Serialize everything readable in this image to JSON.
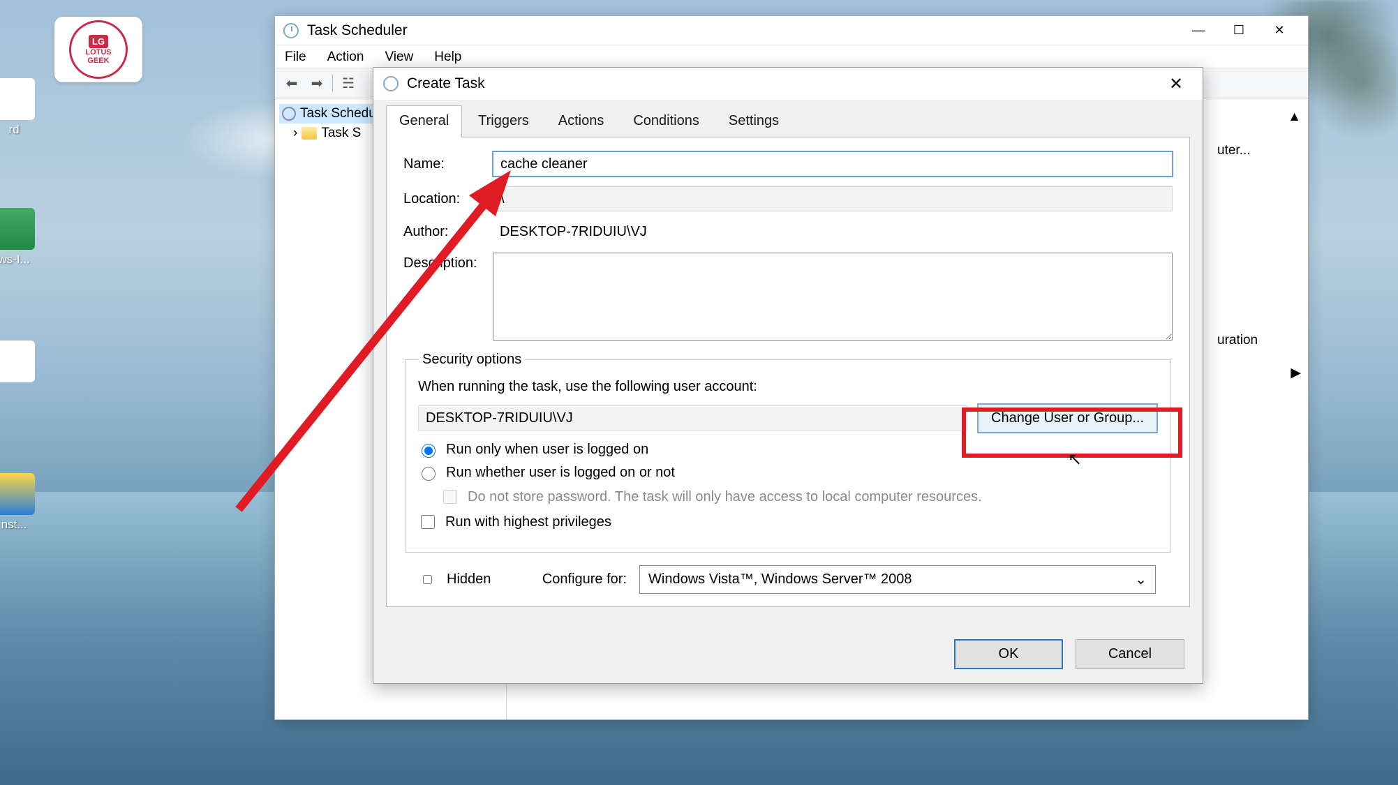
{
  "desktop": {
    "icons": [
      {
        "label": "rd"
      },
      {
        "label": "ws-I..."
      },
      {
        "label": ""
      },
      {
        "label": "nst..."
      }
    ],
    "logo": {
      "text_top": "LOTUS",
      "text_bottom": "GEEK",
      "badge": "LG"
    }
  },
  "parent_window": {
    "title": "Task Scheduler",
    "menu": [
      "File",
      "Action",
      "View",
      "Help"
    ],
    "tree": {
      "root": "Task Scheduler",
      "child": "Task S"
    },
    "right_pane_snippets": [
      "uter...",
      "uration"
    ]
  },
  "dialog": {
    "title": "Create Task",
    "tabs": [
      "General",
      "Triggers",
      "Actions",
      "Conditions",
      "Settings"
    ],
    "active_tab": 0,
    "labels": {
      "name": "Name:",
      "location": "Location:",
      "author": "Author:",
      "description": "Description:"
    },
    "name_value": "cache cleaner",
    "location_value": "\\",
    "author_value": "DESKTOP-7RIDUIU\\VJ",
    "description_value": "",
    "security": {
      "legend": "Security options",
      "running_text": "When running the task, use the following user account:",
      "account": "DESKTOP-7RIDUIU\\VJ",
      "change_btn": "Change User or Group...",
      "radio1": "Run only when user is logged on",
      "radio2": "Run whether user is logged on or not",
      "no_store_pwd": "Do not store password.  The task will only have access to local computer resources.",
      "highest_priv": "Run with highest privileges"
    },
    "hidden_label": "Hidden",
    "configure_label": "Configure for:",
    "configure_value": "Windows Vista™, Windows Server™ 2008",
    "ok": "OK",
    "cancel": "Cancel"
  }
}
